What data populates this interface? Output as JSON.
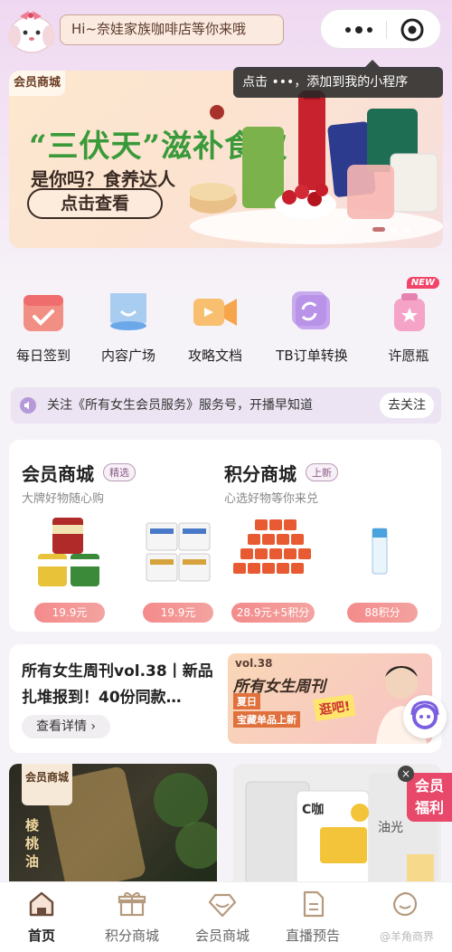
{
  "header": {
    "greeting": "Hi~奈娃家族咖啡店等你来哦",
    "more_icon": "more-dots-icon",
    "close_icon": "target-close-icon"
  },
  "tooltip": {
    "text": "点击 •••，添加到我的小程序"
  },
  "banner": {
    "tag": "会员商城",
    "title": "“三伏天”滋补食饮",
    "subtitle": "是你吗？食养达人",
    "cta": "点击查看",
    "slide_count": 3,
    "active_slide": 1
  },
  "quick_links": [
    {
      "label": "每日签到",
      "icon": "checkin-icon"
    },
    {
      "label": "内容广场",
      "icon": "content-plaza-icon"
    },
    {
      "label": "攻略文档",
      "icon": "video-guide-icon"
    },
    {
      "label": "TB订单转换",
      "icon": "order-convert-icon"
    },
    {
      "label": "许愿瓶",
      "icon": "wish-bottle-icon",
      "badge": "NEW"
    }
  ],
  "notice": {
    "text": "关注《所有女生会员服务》服务号，开播早知道",
    "button": "去关注"
  },
  "mall": {
    "member": {
      "title": "会员商城",
      "badge": "精选",
      "subtitle": "大牌好物随心购"
    },
    "points": {
      "title": "积分商城",
      "badge": "上新",
      "subtitle": "心选好物等你来兑"
    },
    "products": [
      {
        "price": "19.9元"
      },
      {
        "price": "19.9元"
      },
      {
        "price": "28.9元+5积分"
      },
      {
        "price": "88积分"
      }
    ]
  },
  "weekly": {
    "title": "所有女生周刊vol.38丨新品扎堆报到！40份同款…",
    "detail_button": "查看详情 ›",
    "poster_vol": "vol.38",
    "poster_title": "所有女生周刊",
    "poster_line1": "夏日",
    "poster_line2": "宝藏单品上新",
    "poster_sale": "逛吧!"
  },
  "cards": {
    "left_tag": "会员商城",
    "left_text": "棱桃油",
    "right_brand": "C咖",
    "right_text": "油光"
  },
  "member_fab": {
    "line1": "会员",
    "line2": "福利",
    "close": "×"
  },
  "tabbar": [
    {
      "label": "首页",
      "icon": "home-icon",
      "active": true
    },
    {
      "label": "积分商城",
      "icon": "gift-icon",
      "active": false
    },
    {
      "label": "会员商城",
      "icon": "diamond-icon",
      "active": false
    },
    {
      "label": "直播预告",
      "icon": "document-icon",
      "active": false
    },
    {
      "label": "我的",
      "icon": "profile-icon",
      "active": false
    }
  ],
  "watermark": "@羊角商界",
  "colors": {
    "accent_pink": "#e8486a",
    "price_pill": "#f48b8b",
    "notice_bg": "#ece4f2",
    "banner_title_green": "#3a9a3a"
  }
}
